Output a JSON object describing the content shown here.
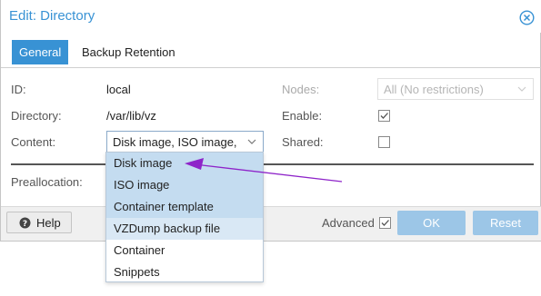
{
  "dialog": {
    "title": "Edit: Directory",
    "close_icon": "close-circle-icon"
  },
  "tabs": [
    {
      "label": "General",
      "active": true
    },
    {
      "label": "Backup Retention",
      "active": false
    }
  ],
  "form": {
    "id_label": "ID:",
    "id_value": "local",
    "directory_label": "Directory:",
    "directory_value": "/var/lib/vz",
    "content_label": "Content:",
    "content_value": "Disk image, ISO image,",
    "nodes_label": "Nodes:",
    "nodes_value": "All (No restrictions)",
    "enable_label": "Enable:",
    "enable_checked": true,
    "shared_label": "Shared:",
    "shared_checked": false,
    "preallocation_label": "Preallocation:"
  },
  "content_dropdown": {
    "options": [
      {
        "label": "Disk image",
        "selected": true
      },
      {
        "label": "ISO image",
        "selected": true
      },
      {
        "label": "Container template",
        "selected": true
      },
      {
        "label": "VZDump backup file",
        "selected": true
      },
      {
        "label": "Container",
        "selected": false
      },
      {
        "label": "Snippets",
        "selected": false
      }
    ]
  },
  "footer": {
    "help_label": "Help",
    "help_icon": "question-circle-icon",
    "advanced_label": "Advanced",
    "advanced_checked": true,
    "ok_label": "OK",
    "reset_label": "Reset"
  },
  "colors": {
    "accent": "#3892d4",
    "button_disabled": "#9cc6e7",
    "selected_item": "#c4dcf0",
    "annotation_arrow": "#8e24c9"
  }
}
